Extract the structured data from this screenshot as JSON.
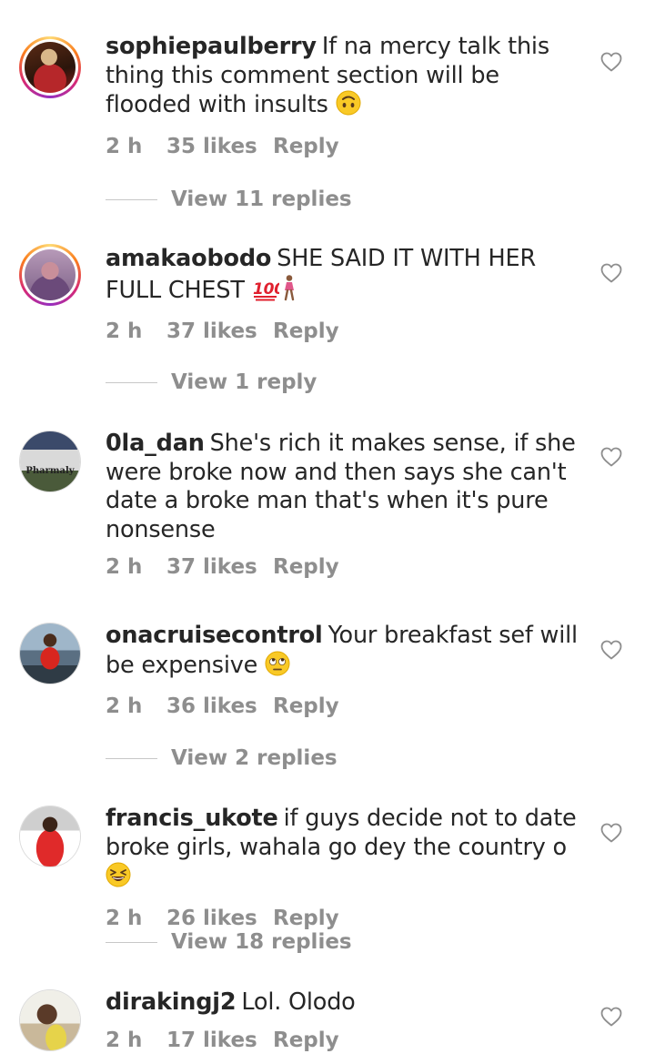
{
  "comments": [
    {
      "username": "sophiepaulberry",
      "text": "If na mercy talk this thing this comment section  will be flooded with insults",
      "emoji": "upside-down-face",
      "time": "2 h",
      "likes": "35 likes",
      "reply": "Reply",
      "view_replies": "View 11 replies"
    },
    {
      "username": "amakaobodo",
      "text": "SHE SAID IT WITH HER FULL CHEST",
      "emoji": "hundred-points + woman-walking",
      "time": "2 h",
      "likes": "37 likes",
      "reply": "Reply",
      "view_replies": "View 1 reply"
    },
    {
      "username": "0la_dan",
      "text": "She's rich it makes sense, if she were broke now and then says she can't date a broke man that's when it's pure nonsense",
      "avatar_text": "Pharmaly",
      "time": "2 h",
      "likes": "37 likes",
      "reply": "Reply"
    },
    {
      "username": "onacruisecontrol",
      "text": "Your breakfast sef will be expensive",
      "emoji": "rolling-eyes-face",
      "time": "2 h",
      "likes": "36 likes",
      "reply": "Reply",
      "view_replies": "View 2 replies"
    },
    {
      "username": "francis_ukote",
      "text": "if guys decide not to date broke girls, wahala go dey the country o",
      "emoji": "grinning-squinting-face",
      "time": "2 h",
      "likes": "26 likes",
      "reply": "Reply",
      "view_replies": "View 18 replies"
    },
    {
      "username": "dirakingj2",
      "text": "Lol. Olodo",
      "time": "2 h",
      "likes": "17 likes",
      "reply": "Reply"
    }
  ],
  "icons": {
    "like": "heart-outline-icon",
    "story_ring_colors": [
      "#feda75",
      "#fa7e1e",
      "#d62976",
      "#962fbf"
    ]
  },
  "colors": {
    "text": "#262626",
    "secondary": "#8e8e8e",
    "divider": "#c7c7c7"
  }
}
